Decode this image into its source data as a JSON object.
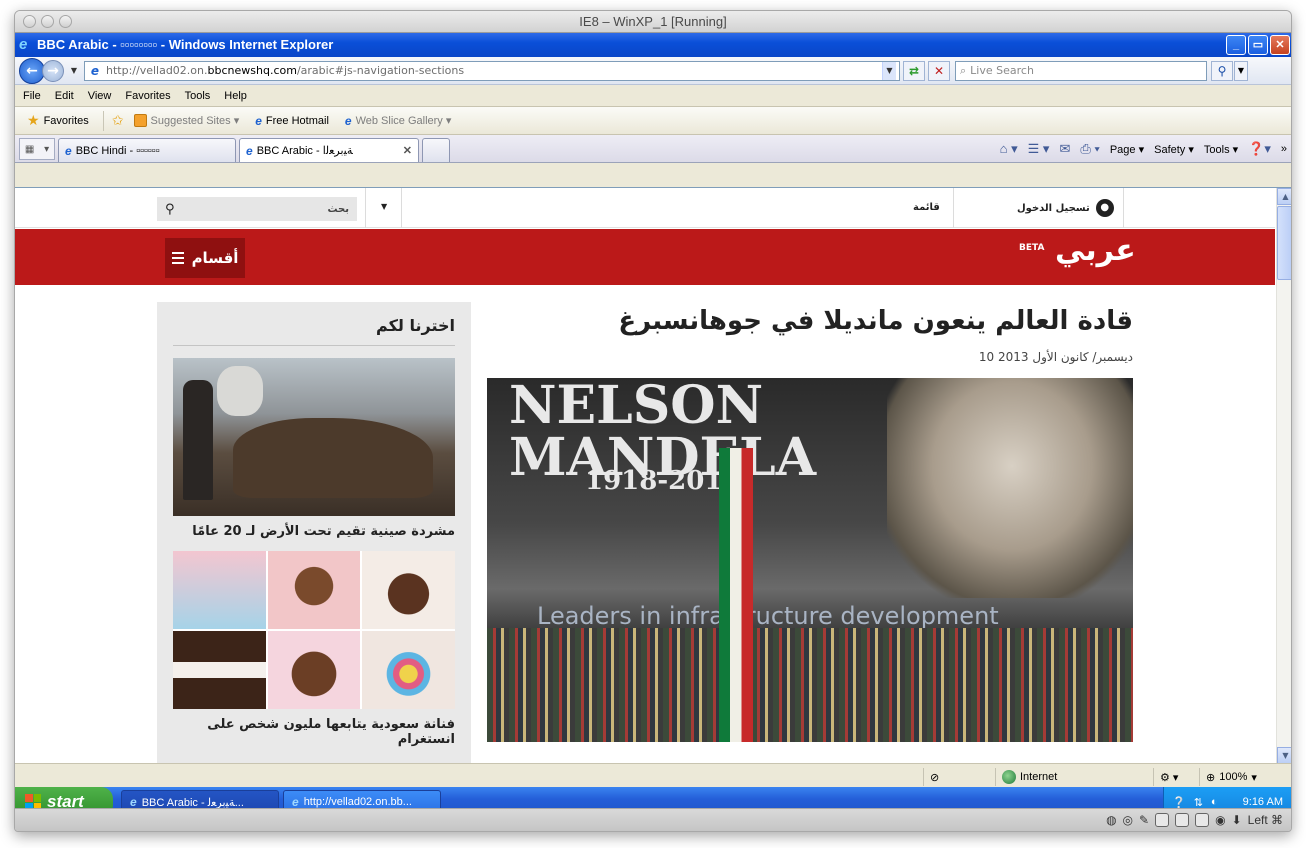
{
  "host": {
    "title": "IE8 – WinXP_1 [Running]",
    "key_label": "Left ⌘"
  },
  "ie": {
    "title": "BBC Arabic - ▫▫▫▫▫▫▫▫ - Windows Internet Explorer",
    "address_prefix": "http://vellad02.on.",
    "address_host": "bbcnewshq.com",
    "address_suffix": "/arabic#js-navigation-sections",
    "search_placeholder": "Live Search",
    "menu": [
      "File",
      "Edit",
      "View",
      "Favorites",
      "Tools",
      "Help"
    ],
    "favorites_label": "Favorites",
    "fav_links": [
      "Suggested Sites ▾",
      "Free Hotmail",
      "Web Slice Gallery ▾"
    ],
    "tabs": [
      {
        "label": "BBC Hindi - ▫▫▫▫▫▫"
      },
      {
        "label": "BBC Arabic - ﺔﻴﺑﺮﻌﻟﺍ"
      }
    ],
    "commands": [
      "Page ▾",
      "Safety ▾",
      "Tools ▾"
    ],
    "status_zone": "Internet",
    "zoom": "100%"
  },
  "bbc": {
    "search_label": "بحث",
    "menu_label": "قائمة",
    "login_label": "تسجيل الدخول",
    "sections_label": "أقسام",
    "brand": "عربي",
    "beta": "BETA",
    "sidebar_title": "اخترنا لكم",
    "sidebar_items": [
      {
        "caption": "مشردة صينية تقيم تحت الأرض لـ 20 عامًا"
      },
      {
        "caption": "فنانة سعودية يتابعها مليون شخص على انستغرام"
      }
    ],
    "headline": "قادة العالم ينعون مانديلا في جوهانسبرغ",
    "date": "10 ديسمبر/ كانون الأول 2013",
    "hero": {
      "line1": "NELSON",
      "line2": "MANDELA",
      "line3": "1918-2013",
      "band": "Leaders in infrastructure development"
    }
  },
  "taskbar": {
    "start": "start",
    "items": [
      "BBC Arabic - ﺔﻴﺑﺮﻌﻟ...",
      "http://vellad02.on.bb..."
    ],
    "clock": "9:16 AM"
  }
}
